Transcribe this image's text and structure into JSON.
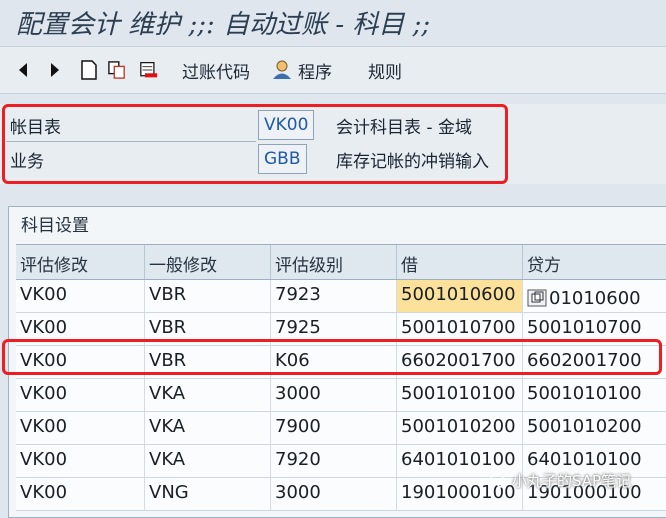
{
  "window": {
    "title": "配置会计 维护 ;;: 自动过账 - 科目 ;;"
  },
  "toolbar": {
    "posting_code_label": "过账代码",
    "procedure_label": "程序",
    "rules_label": "规则"
  },
  "header": {
    "chart_label": "帐目表",
    "chart_value": "VK00",
    "chart_desc": "会计科目表 - 金域",
    "transaction_label": "业务",
    "transaction_value": "GBB",
    "transaction_desc": "库存记帐的冲销输入"
  },
  "panel": {
    "title": "科目设置"
  },
  "table": {
    "columns": [
      "评估修改",
      "一般修改",
      "评估级别",
      "借",
      "贷方"
    ],
    "rows": [
      [
        "VK00",
        "VBR",
        "7923",
        "5001010600",
        "01010600"
      ],
      [
        "VK00",
        "VBR",
        "7925",
        "5001010700",
        "5001010700"
      ],
      [
        "VK00",
        "VBR",
        "K06",
        "6602001700",
        "6602001700"
      ],
      [
        "VK00",
        "VKA",
        "3000",
        "5001010100",
        "5001010100"
      ],
      [
        "VK00",
        "VKA",
        "7900",
        "5001010200",
        "5001010200"
      ],
      [
        "VK00",
        "VKA",
        "7920",
        "6401010100",
        "6401010100"
      ],
      [
        "VK00",
        "VNG",
        "3000",
        "1901000100",
        "1901000100"
      ]
    ]
  },
  "watermark": {
    "text": "小丸子的SAP笔记"
  },
  "colors": {
    "highlight_box": "#ee1c23",
    "focused_cell": "#fbe19a",
    "field_value": "#1e5aa8"
  }
}
